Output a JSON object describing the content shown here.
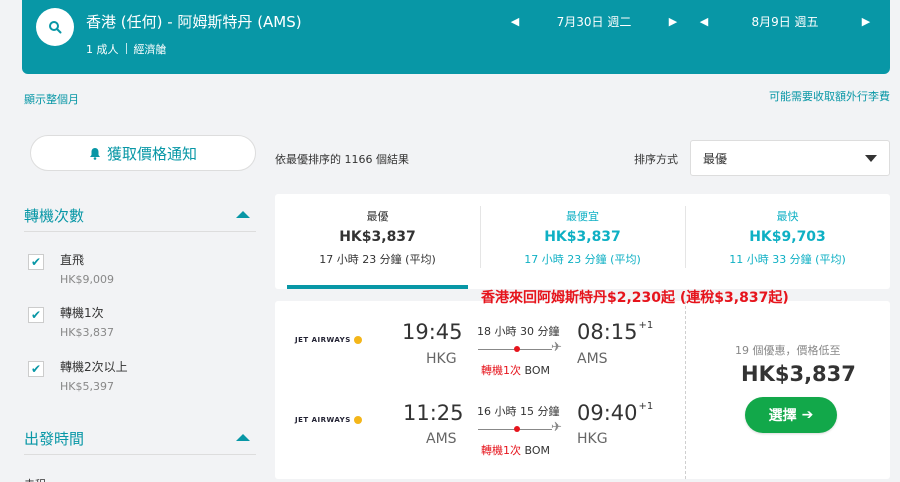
{
  "header": {
    "route": "香港 (任何) - 阿姆斯特丹 (AMS)",
    "passengers": "1 成人",
    "cabin": "經濟艙",
    "depart_date": "7月30日 週二",
    "return_date": "8月9日 週五"
  },
  "links": {
    "show_month": "顯示整個月",
    "extra_fees": "可能需要收取額外行李費"
  },
  "sidebar": {
    "price_alert": "獲取價格通知",
    "stops_title": "轉機次數",
    "stops": [
      {
        "label": "直飛",
        "price": "HK$9,009",
        "checked": true
      },
      {
        "label": "轉機1次",
        "price": "HK$3,837",
        "checked": true
      },
      {
        "label": "轉機2次以上",
        "price": "HK$5,397",
        "checked": true
      }
    ],
    "departure_title": "出發時間",
    "cut_text": "去程"
  },
  "results": {
    "count_text": "依最優排序的 1166 個結果",
    "sort_label": "排序方式",
    "sort_value": "最優"
  },
  "tabs": [
    {
      "label": "最優",
      "price": "HK$3,837",
      "duration": "17 小時 23 分鐘 (平均)"
    },
    {
      "label": "最便宜",
      "price": "HK$3,837",
      "duration": "17 小時 23 分鐘 (平均)"
    },
    {
      "label": "最快",
      "price": "HK$9,703",
      "duration": "11 小時 33 分鐘 (平均)"
    }
  ],
  "promo": "香港來回阿姆斯特丹$2,230起 (連稅$3,837起)",
  "card": {
    "legs": [
      {
        "airline": "JET AIRWAYS",
        "dep_time": "19:45",
        "dep_airport": "HKG",
        "duration": "18 小時 30 分鐘",
        "arr_time": "08:15",
        "arr_offset": "+1",
        "arr_airport": "AMS",
        "stops": "轉機1次",
        "via": "BOM"
      },
      {
        "airline": "JET AIRWAYS",
        "dep_time": "11:25",
        "dep_airport": "AMS",
        "duration": "16 小時 15 分鐘",
        "arr_time": "09:40",
        "arr_offset": "+1",
        "arr_airport": "HKG",
        "stops": "轉機1次",
        "via": "BOM"
      }
    ],
    "offers_text": "19 個優惠，價格低至",
    "price": "HK$3,837",
    "select_label": "選擇"
  },
  "colors": {
    "accent": "#0897a6",
    "cyan": "#0fb0c4",
    "green": "#12a84a",
    "red": "#e6141c"
  },
  "icons": {
    "search": "search-icon",
    "bell": "bell-icon",
    "plane": "plane-icon",
    "arrow": "arrow-right-icon"
  }
}
